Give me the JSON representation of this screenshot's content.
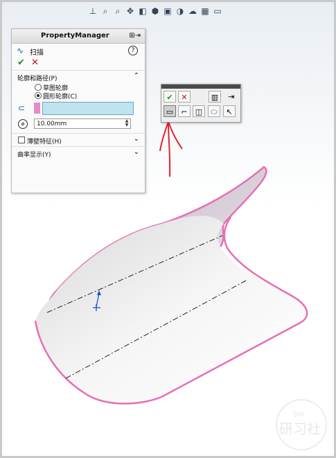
{
  "toolbar": {
    "icons": [
      "view-orientation-icon",
      "zoom-icon",
      "zoom-area-icon",
      "pan-icon",
      "section-view-icon",
      "display-style-icon",
      "hide-show-icon",
      "appearance-icon",
      "scene-icon",
      "render-icon",
      "monitor-icon"
    ]
  },
  "property_manager": {
    "title": "PropertyManager",
    "feature_name": "扫描",
    "help_symbol": "?",
    "ok_symbol": "✔",
    "cancel_symbol": "✕",
    "section_profile_path": {
      "label": "轮廓和路径(P)",
      "collapse_symbol": "⌃",
      "option_sketch_profile": "草图轮廓",
      "option_circular_profile": "圆形轮廓(C)",
      "selected_option": "圆形轮廓(C)",
      "selection_value": "",
      "diameter_value": "10.00mm"
    },
    "section_thin_feature": {
      "label": "薄壁特征(H)",
      "expand_symbol": "⌄"
    },
    "section_curvature_display": {
      "label": "曲率显示(Y)",
      "expand_symbol": "⌄"
    }
  },
  "selection_popup": {
    "ok_symbol": "✔",
    "cancel_symbol": "✕",
    "pin_symbol": "⇥"
  },
  "colors": {
    "accent_pink": "#e66fb5",
    "annotation_red": "#e0242c",
    "ok_green": "#1e8c1e",
    "cancel_red": "#c0121b",
    "selection_blue": "#bfe3f0"
  }
}
